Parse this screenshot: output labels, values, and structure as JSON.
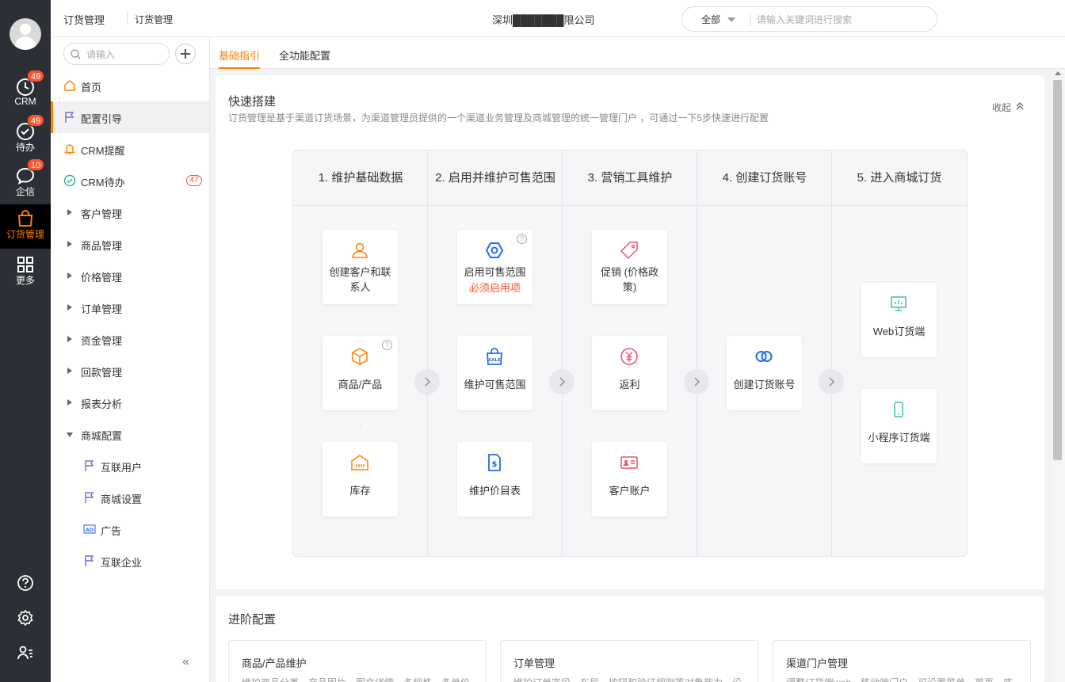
{
  "rail": {
    "items": [
      {
        "label": "CRM",
        "badge": "49",
        "icon": "clock-icon"
      },
      {
        "label": "待办",
        "badge": "49",
        "icon": "check-circle-icon"
      },
      {
        "label": "企信",
        "badge": "10",
        "icon": "chat-bubble-icon"
      },
      {
        "label": "订货管理",
        "badge": "",
        "icon": "shopping-bag-icon"
      },
      {
        "label": "更多",
        "badge": "",
        "icon": "grid-icon"
      }
    ],
    "bottom_icons": [
      "help-icon",
      "settings-icon",
      "user-list-icon"
    ],
    "accent_color": "#ff8000"
  },
  "header": {
    "crumb_primary": "订货管理",
    "crumb_secondary": "订货管理",
    "company": "深圳███████限公司",
    "search": {
      "scope": "全部",
      "placeholder": "请输入关键词进行搜索"
    }
  },
  "sidebar": {
    "search_placeholder": "请输入",
    "items": [
      {
        "label": "首页",
        "icon": "home-icon"
      },
      {
        "label": "配置引导",
        "icon": "flag-icon",
        "active": true
      },
      {
        "label": "CRM提醒",
        "icon": "bell-icon"
      },
      {
        "label": "CRM待办",
        "icon": "check-circle-icon",
        "badge": "47"
      },
      {
        "label": "客户管理",
        "expandable": true
      },
      {
        "label": "商品管理",
        "expandable": true
      },
      {
        "label": "价格管理",
        "expandable": true
      },
      {
        "label": "订单管理",
        "expandable": true
      },
      {
        "label": "资金管理",
        "expandable": true
      },
      {
        "label": "回款管理",
        "expandable": true
      },
      {
        "label": "报表分析",
        "expandable": true
      },
      {
        "label": "商城配置",
        "expandable": true,
        "expanded": true
      }
    ],
    "sub_items": [
      {
        "label": "互联用户",
        "icon": "flag-icon"
      },
      {
        "label": "商城设置",
        "icon": "flag-icon"
      },
      {
        "label": "广告",
        "icon": "ad-icon"
      },
      {
        "label": "互联企业",
        "icon": "flag-icon"
      }
    ],
    "collapse_label": "«"
  },
  "tabs": [
    {
      "label": "基础指引",
      "active": true
    },
    {
      "label": "全功能配置",
      "active": false
    }
  ],
  "quick_setup": {
    "title": "快速搭建",
    "description": "订货管理是基于渠道订货场景，为渠道管理员提供的一个渠道业务管理及商城管理的统一管理门户 ，可通过一下5步快速进行配置",
    "collapse_label": "收起",
    "steps": [
      {
        "title": "1. 维护基础数据"
      },
      {
        "title": "2. 启用并维护可售范围"
      },
      {
        "title": "3. 营销工具维护"
      },
      {
        "title": "4. 创建订货账号"
      },
      {
        "title": "5. 进入商城订货"
      }
    ],
    "cards": {
      "c1": {
        "label": "创建客户和联系人",
        "icon": "user-icon"
      },
      "c2": {
        "label": "商品/产品",
        "icon": "cube-icon"
      },
      "c3": {
        "label": "库存",
        "icon": "warehouse-icon"
      },
      "c4": {
        "label": "启用可售范围",
        "required": "必须启用项",
        "icon": "hexagon-icon"
      },
      "c5": {
        "label": "维护可售范围",
        "icon": "sale-bag-icon"
      },
      "c6": {
        "label": "维护价目表",
        "icon": "price-doc-icon"
      },
      "c7": {
        "label": "促销 (价格政策)",
        "icon": "tag-icon"
      },
      "c8": {
        "label": "返利",
        "icon": "yen-icon"
      },
      "c9": {
        "label": "客户账户",
        "icon": "id-card-icon"
      },
      "c10": {
        "label": "创建订货账号",
        "icon": "rings-icon"
      },
      "c11": {
        "label": "Web订货端",
        "icon": "monitor-icon"
      },
      "c12": {
        "label": "小程序订货端",
        "icon": "phone-icon"
      }
    },
    "help_mark": "?"
  },
  "advanced": {
    "title": "进阶配置",
    "cards": [
      {
        "title": "商品/产品维护",
        "desc": "维护商品分类、产品图片、图文详情、多规格、多单位"
      },
      {
        "title": "订单管理",
        "desc": "维护订单字段、布局、按钮和验证规则等对象能力，设"
      },
      {
        "title": "渠道门户管理",
        "desc": "调整订货端web、移动端门户，可设置菜单、首页、底"
      }
    ]
  }
}
